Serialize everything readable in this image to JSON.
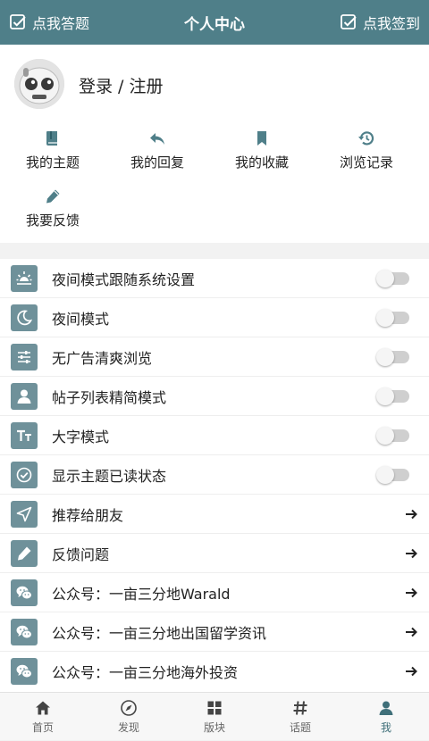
{
  "header": {
    "left_label": "点我答题",
    "title": "个人中心",
    "right_label": "点我签到"
  },
  "profile": {
    "login_label": "登录 / 注册"
  },
  "quick_links": [
    {
      "label": "我的主题",
      "icon": "book-icon"
    },
    {
      "label": "我的回复",
      "icon": "reply-icon"
    },
    {
      "label": "我的收藏",
      "icon": "bookmark-icon"
    },
    {
      "label": "浏览记录",
      "icon": "history-icon"
    },
    {
      "label": "我要反馈",
      "icon": "pencil-icon"
    }
  ],
  "settings": [
    {
      "label": "夜间模式跟随系统设置",
      "icon": "sunrise-icon",
      "control": "toggle",
      "on": false
    },
    {
      "label": "夜间模式",
      "icon": "moon-icon",
      "control": "toggle",
      "on": false
    },
    {
      "label": "无广告清爽浏览",
      "icon": "sliders-icon",
      "control": "toggle",
      "on": false
    },
    {
      "label": "帖子列表精简模式",
      "icon": "person-icon",
      "control": "toggle",
      "on": false
    },
    {
      "label": "大字模式",
      "icon": "text-size-icon",
      "control": "toggle",
      "on": false
    },
    {
      "label": "显示主题已读状态",
      "icon": "check-circle-icon",
      "control": "toggle",
      "on": false
    },
    {
      "label": "推荐给朋友",
      "icon": "send-icon",
      "control": "arrow"
    },
    {
      "label": "反馈问题",
      "icon": "pencil-icon",
      "control": "arrow"
    },
    {
      "label": "公众号：一亩三分地Warald",
      "icon": "wechat-icon",
      "control": "arrow"
    },
    {
      "label": "公众号：一亩三分地出国留学资讯",
      "icon": "wechat-icon",
      "control": "arrow"
    },
    {
      "label": "公众号：一亩三分地海外投资",
      "icon": "wechat-icon",
      "control": "arrow"
    }
  ],
  "tabs": [
    {
      "label": "首页",
      "icon": "home-icon",
      "active": false
    },
    {
      "label": "发现",
      "icon": "compass-icon",
      "active": false
    },
    {
      "label": "版块",
      "icon": "grid-icon",
      "active": false
    },
    {
      "label": "话题",
      "icon": "hashtag-icon",
      "active": false
    },
    {
      "label": "我",
      "icon": "user-icon",
      "active": true
    }
  ],
  "colors": {
    "brand": "#4f7f89",
    "icon_box": "#6f919a",
    "active_tab": "#3f6f79"
  }
}
